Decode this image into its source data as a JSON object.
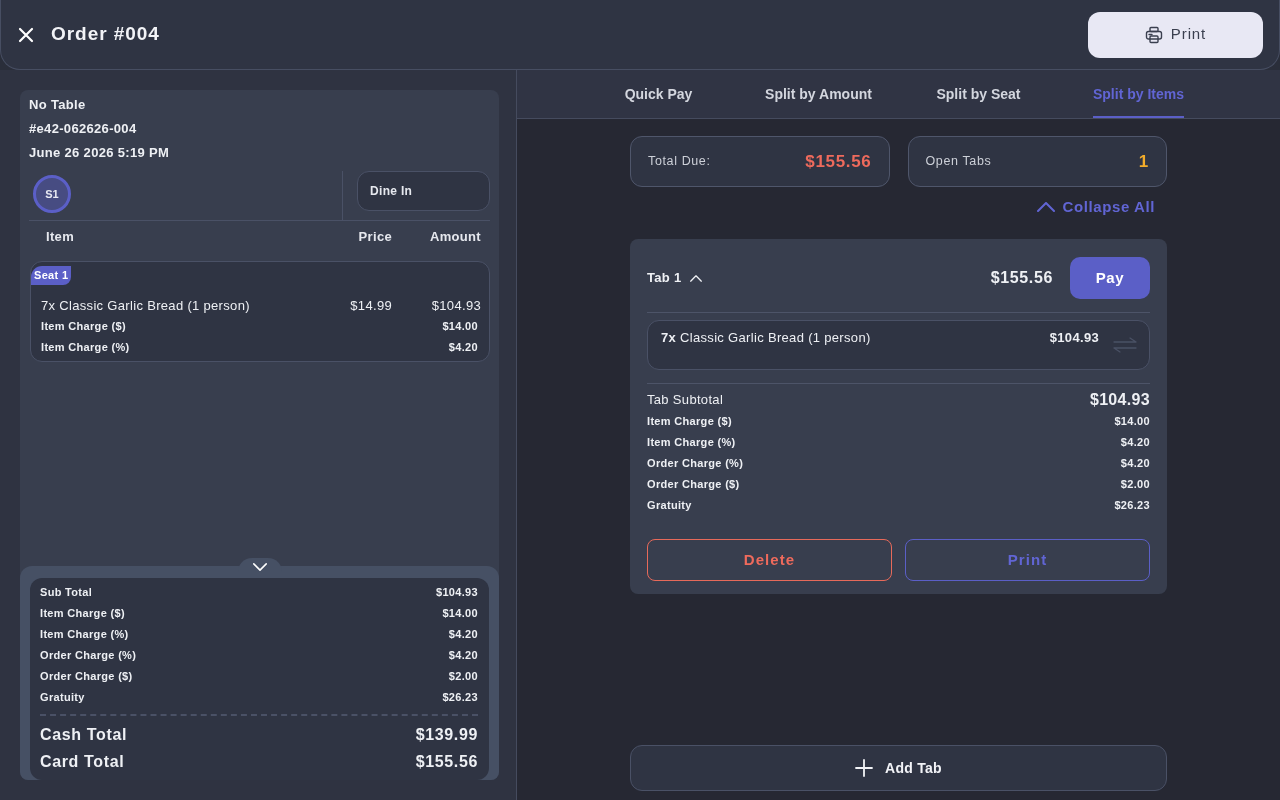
{
  "header": {
    "title": "Order #004",
    "print_button": "Print"
  },
  "order": {
    "table": "No Table",
    "number": "#e42-062626-004",
    "datetime": "June 26 2026 5:19 PM",
    "seats": [
      {
        "label": "S1",
        "selected": true
      }
    ],
    "order_type": "Dine In",
    "columns": [
      "Item",
      "Price",
      "Amount"
    ],
    "seat_groups": [
      {
        "badge": "Seat 1",
        "items": [
          {
            "quantity": "7x",
            "name": "Classic Garlic Bread (1 person)",
            "price": "$14.99",
            "amount": "$104.93",
            "charges": [
              {
                "label": "Item Charge ($)",
                "amount": "$14.00"
              },
              {
                "label": "Item Charge (%)",
                "amount": "$4.20"
              }
            ]
          }
        ]
      }
    ]
  },
  "summary": {
    "expanded": true,
    "rows": [
      {
        "label": "Sub Total",
        "amount": "$104.93"
      },
      {
        "label": "Item Charge ($)",
        "amount": "$14.00"
      },
      {
        "label": "Item Charge (%)",
        "amount": "$4.20"
      },
      {
        "label": "Order Charge (%)",
        "amount": "$4.20"
      },
      {
        "label": "Order Charge ($)",
        "amount": "$2.00"
      },
      {
        "label": "Gratuity",
        "amount": "$26.23"
      }
    ],
    "totals": [
      {
        "label": "Cash Total",
        "amount": "$139.99"
      },
      {
        "label": "Card Total",
        "amount": "$155.56"
      }
    ]
  },
  "payment_tabs": [
    {
      "label": "Quick Pay",
      "selected": false
    },
    {
      "label": "Split by Amount",
      "selected": false
    },
    {
      "label": "Split by Seat",
      "selected": false
    },
    {
      "label": "Split by Items",
      "selected": true
    }
  ],
  "stats": [
    {
      "label": "Total Due:",
      "value": "$155.56",
      "color": "#ee6a5c"
    },
    {
      "label": "Open Tabs",
      "value": "1",
      "color": "#f2ac2a"
    }
  ],
  "collapse_all": "Collapse All",
  "tabs": [
    {
      "title": "Tab 1",
      "expanded": true,
      "total": "$155.56",
      "pay_button": "Pay",
      "items": [
        {
          "quantity": "7x",
          "name": "Classic Garlic Bread (1 person)",
          "amount": "$104.93"
        }
      ],
      "subtotal_label": "Tab Subtotal",
      "subtotal": "$104.93",
      "charges": [
        {
          "label": "Item Charge ($)",
          "amount": "$14.00"
        },
        {
          "label": "Item Charge (%)",
          "amount": "$4.20"
        },
        {
          "label": "Order Charge (%)",
          "amount": "$4.20"
        },
        {
          "label": "Order Charge ($)",
          "amount": "$2.00"
        },
        {
          "label": "Gratuity",
          "amount": "$26.23"
        }
      ],
      "delete_button": "Delete",
      "print_button": "Print"
    }
  ],
  "add_tab_button": "Add Tab"
}
